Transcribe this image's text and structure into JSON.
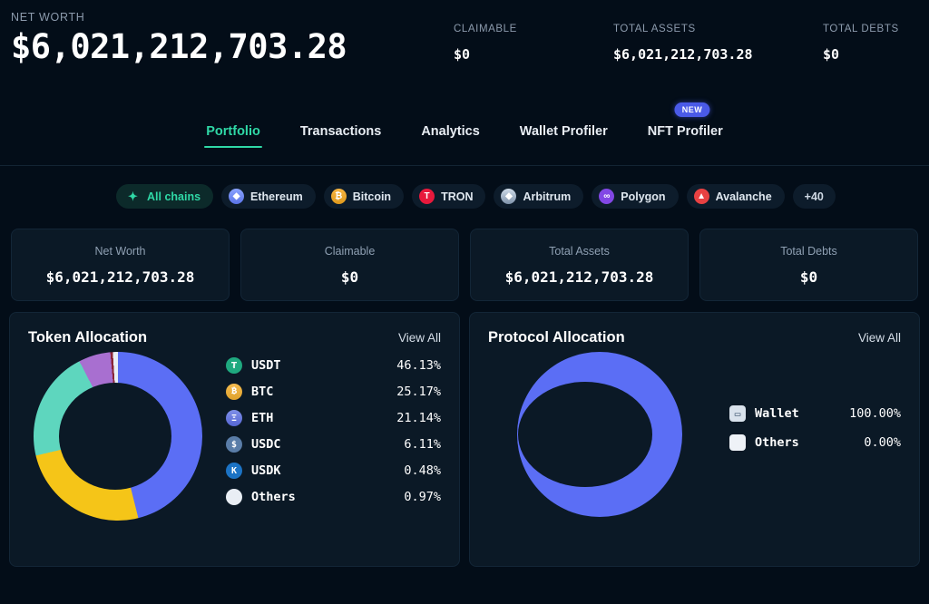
{
  "hero": {
    "label": "NET WORTH",
    "value": "$6,021,212,703.28",
    "stats": [
      {
        "label": "CLAIMABLE",
        "value": "$0"
      },
      {
        "label": "TOTAL ASSETS",
        "value": "$6,021,212,703.28"
      },
      {
        "label": "TOTAL DEBTS",
        "value": "$0"
      }
    ]
  },
  "tabs": [
    {
      "label": "Portfolio",
      "active": true
    },
    {
      "label": "Transactions",
      "active": false
    },
    {
      "label": "Analytics",
      "active": false
    },
    {
      "label": "Wallet Profiler",
      "active": false
    },
    {
      "label": "NFT Profiler",
      "active": false,
      "badge": "NEW"
    }
  ],
  "chains": [
    {
      "label": "All chains",
      "icon": "sparkle-icon",
      "selected": true
    },
    {
      "label": "Ethereum",
      "icon": "ethereum-icon",
      "glyph": "♦"
    },
    {
      "label": "Bitcoin",
      "icon": "bitcoin-icon",
      "glyph": "₿"
    },
    {
      "label": "TRON",
      "icon": "tron-icon",
      "glyph": "T"
    },
    {
      "label": "Arbitrum",
      "icon": "arbitrum-icon",
      "glyph": "◆"
    },
    {
      "label": "Polygon",
      "icon": "polygon-icon",
      "glyph": "∞"
    },
    {
      "label": "Avalanche",
      "icon": "avalanche-icon",
      "glyph": "▲"
    },
    {
      "label": "+40",
      "icon": "more-chains",
      "more": true
    }
  ],
  "stat_cards": [
    {
      "label": "Net Worth",
      "value": "$6,021,212,703.28"
    },
    {
      "label": "Claimable",
      "value": "$0"
    },
    {
      "label": "Total Assets",
      "value": "$6,021,212,703.28"
    },
    {
      "label": "Total Debts",
      "value": "$0"
    }
  ],
  "token_card": {
    "title": "Token Allocation",
    "view_all": "View All"
  },
  "protocol_card": {
    "title": "Protocol Allocation",
    "view_all": "View All"
  },
  "chart_data": [
    {
      "type": "pie",
      "title": "Token Allocation",
      "legend_position": "right",
      "donut": true,
      "categories": [
        "USDT",
        "BTC",
        "ETH",
        "USDC",
        "USDK",
        "Others"
      ],
      "values": [
        46.13,
        25.17,
        21.14,
        6.11,
        0.48,
        0.97
      ],
      "value_labels": [
        "46.13%",
        "25.17%",
        "21.14%",
        "6.11%",
        "0.48%",
        "0.97%"
      ],
      "colors": [
        "#5b6ef5",
        "#f5c518",
        "#5ed6be",
        "#a86fd0",
        "#8a2436",
        "#e9eef4"
      ],
      "icon_colors": {
        "USDT": "#1fa97f",
        "BTC": "#e8a82c",
        "ETH": "#6a7ce0",
        "USDC": "#5a7da8",
        "USDK": "#1c73c4",
        "Others": "#e9eef4"
      }
    },
    {
      "type": "pie",
      "title": "Protocol Allocation",
      "legend_position": "right",
      "donut": true,
      "categories": [
        "Wallet",
        "Others"
      ],
      "values": [
        100.0,
        0.0
      ],
      "value_labels": [
        "100.00%",
        "0.00%"
      ],
      "colors": [
        "#5b6ef5",
        "#eef2f7"
      ]
    }
  ],
  "colors": {
    "background": "#030d18",
    "card": "#0b1926",
    "card_border": "#132637",
    "accent_teal": "#2fd8a6",
    "accent_blue": "#5b6ef5",
    "badge_blue": "#4a5ae8",
    "text_primary": "#ffffff",
    "text_muted": "#8c9bad"
  }
}
